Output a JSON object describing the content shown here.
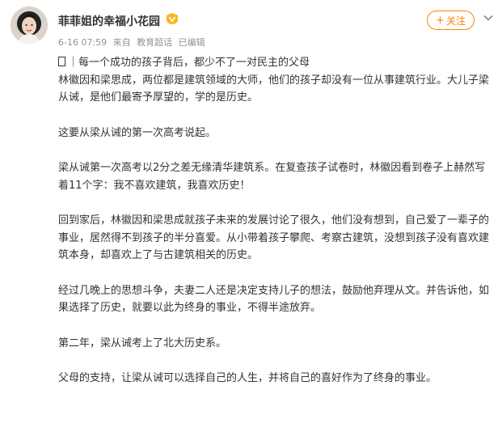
{
  "post": {
    "author": "菲菲姐的幸福小花园",
    "meta": {
      "time": "6-16 07:59",
      "source_prefix": "来自",
      "source": "教育超话",
      "edited": "已编辑"
    },
    "follow_label": "关注",
    "follow_icon": "plus-icon",
    "more_icon": "chevron-down-icon",
    "vip_icon": "vip-badge-icon",
    "colors": {
      "accent": "#ff8200",
      "meta": "#939393",
      "text": "#333333"
    },
    "paragraphs": [
      "｜每一个成功的孩子背后，都少不了一对民主的父母",
      "林徽因和梁思成，两位都是建筑领域的大师，他们的孩子却没有一位从事建筑行业。大儿子梁从诫，是他们最寄予厚望的，学的是历史。",
      "这要从梁从诫的第一次高考说起。",
      "梁从诫第一次高考以2分之差无缘清华建筑系。在复查孩子试卷时，林徽因看到卷子上赫然写着11个字：我不喜欢建筑，我喜欢历史！",
      "回到家后，林徽因和梁思成就孩子未来的发展讨论了很久，他们没有想到，自己爱了一辈子的事业，居然得不到孩子的半分喜爱。从小带着孩子攀爬、考察古建筑，没想到孩子没有喜欢建筑本身，却喜欢上了与古建筑相关的历史。",
      "经过几晚上的思想斗争，夫妻二人还是决定支持儿子的想法，鼓励他弃理从文。并告诉他，如果选择了历史，就要以此为终身的事业，不得半途放弃。",
      "第二年，梁从诫考上了北大历史系。",
      "父母的支持，让梁从诫可以选择自己的人生，并将自己的喜好作为了终身的事业。"
    ]
  }
}
